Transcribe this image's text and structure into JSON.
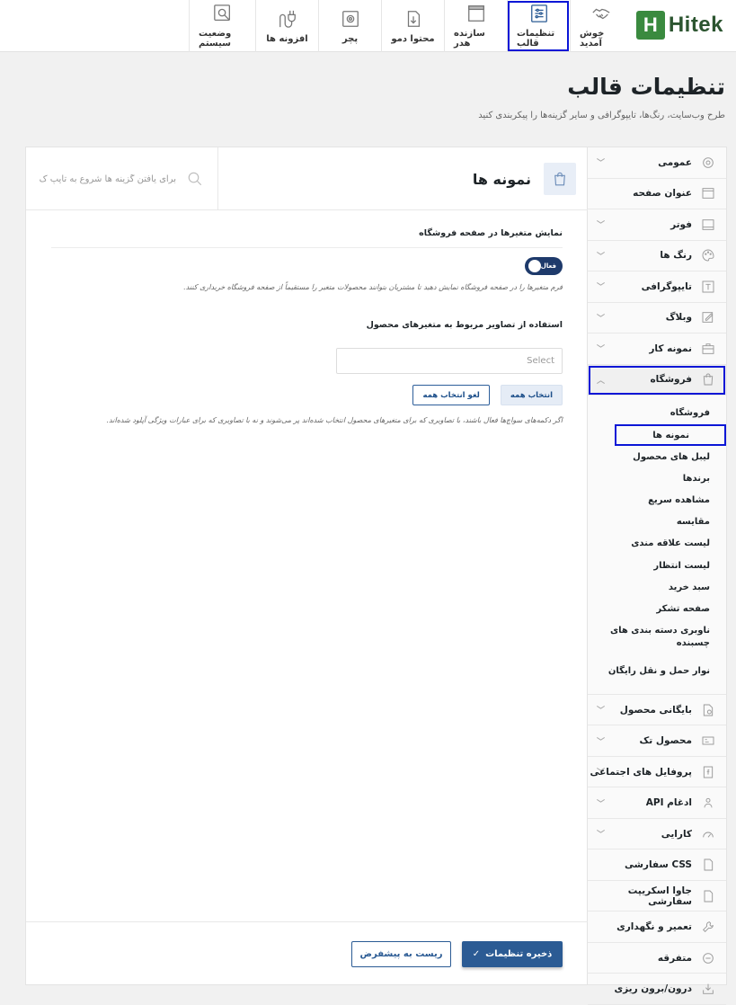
{
  "brand": {
    "logo_letter": "H",
    "logo_text": "Hitek",
    "color": "#3a8a3f"
  },
  "topnav": [
    {
      "label": "خوش آمدید",
      "icon": "handshake-icon"
    },
    {
      "label": "تنظیمات قالب",
      "icon": "sliders-icon",
      "active": true
    },
    {
      "label": "سازنده هدر",
      "icon": "header-builder-icon"
    },
    {
      "label": "محتوا دمو",
      "icon": "download-icon"
    },
    {
      "label": "پچر",
      "icon": "patcher-icon"
    },
    {
      "label": "افزونه ها",
      "icon": "plug-icon"
    },
    {
      "label": "وضعیت سیستم",
      "icon": "system-status-icon"
    }
  ],
  "page": {
    "title": "تنظیمات قالب",
    "subtitle": "طرح وب‌سایت، رنگ‌ها، تایپوگرافی و سایر گزینه‌ها را پیکربندی کنید"
  },
  "sidebar": {
    "items_before": [
      {
        "label": "عمومی",
        "icon": "gear-icon",
        "chevron": true
      },
      {
        "label": "عنوان صفحه",
        "icon": "page-title-icon",
        "chevron": false
      },
      {
        "label": "فوتر",
        "icon": "footer-icon",
        "chevron": true
      },
      {
        "label": "رنگ ها",
        "icon": "palette-icon",
        "chevron": true
      },
      {
        "label": "تایپوگرافی",
        "icon": "typography-icon",
        "chevron": true
      },
      {
        "label": "وبلاگ",
        "icon": "blog-icon",
        "chevron": true
      },
      {
        "label": "نمونه کار",
        "icon": "briefcase-icon",
        "chevron": true
      }
    ],
    "selected": {
      "label": "فروشگاه",
      "icon": "shopping-bag-icon"
    },
    "subitems": [
      "فروشگاه",
      "نمونه ها",
      "لیبل های محصول",
      "برندها",
      "مشاهده سریع",
      "مقایسه",
      "لیست علاقه مندی",
      "لیست انتظار",
      "سبد خرید",
      "صفحه تشکر",
      "ناوبری دسته بندی های چسبنده",
      "نوار حمل و نقل رایگان"
    ],
    "current_subitem": "نمونه ها",
    "items_after": [
      {
        "label": "بایگانی محصول",
        "icon": "archive-icon",
        "chevron": true
      },
      {
        "label": "محصول تک",
        "icon": "single-product-icon",
        "chevron": true
      },
      {
        "label": "پروفایل های اجتماعی",
        "icon": "social-icon",
        "chevron": true
      },
      {
        "label": "ادغام API",
        "icon": "api-icon",
        "chevron": true
      },
      {
        "label": "کارایی",
        "icon": "performance-icon",
        "chevron": true
      },
      {
        "label": "CSS سفارشی",
        "icon": "css-icon",
        "chevron": false
      },
      {
        "label": "جاوا اسکریپت سفارشی",
        "icon": "js-icon",
        "chevron": false
      },
      {
        "label": "تعمیر و نگهداری",
        "icon": "maintenance-icon",
        "chevron": false
      },
      {
        "label": "متفرقه",
        "icon": "misc-icon",
        "chevron": false
      },
      {
        "label": "درون/برون ریزی",
        "icon": "import-export-icon",
        "chevron": false
      }
    ]
  },
  "section": {
    "title": "نمونه ها",
    "search_placeholder": "برای یافتن گزینه ها شروع به تایپ ک"
  },
  "option1": {
    "label": "نمایش متغیرها در صفحه فروشگاه",
    "toggle_label": "فعال",
    "toggle_on": true,
    "description": "فرم متغیرها را در صفحه فروشگاه نمایش دهید تا مشتریان بتوانند محصولات متغیر را مستقیماً از صفحه فروشگاه خریداری کنند."
  },
  "option2": {
    "label": "استفاده از تصاویر مربوط به متغیرهای محصول",
    "select_placeholder": "Select",
    "select_all": "انتخاب همه",
    "deselect_all": "لغو انتخاب همه",
    "description": "اگر دکمه‌های سواچ‌ها فعال باشند، با تصاویری که برای متغیرهای محصول انتخاب شده‌اند پر می‌شوند و نه با تصاویری که برای عبارات ویژگی آپلود شده‌اند."
  },
  "footer": {
    "save": "ذخیره تنظیمات",
    "reset": "ریست به پیشفرض"
  },
  "colors": {
    "accent": "#2b5b94",
    "highlight": "#0a16d6"
  }
}
